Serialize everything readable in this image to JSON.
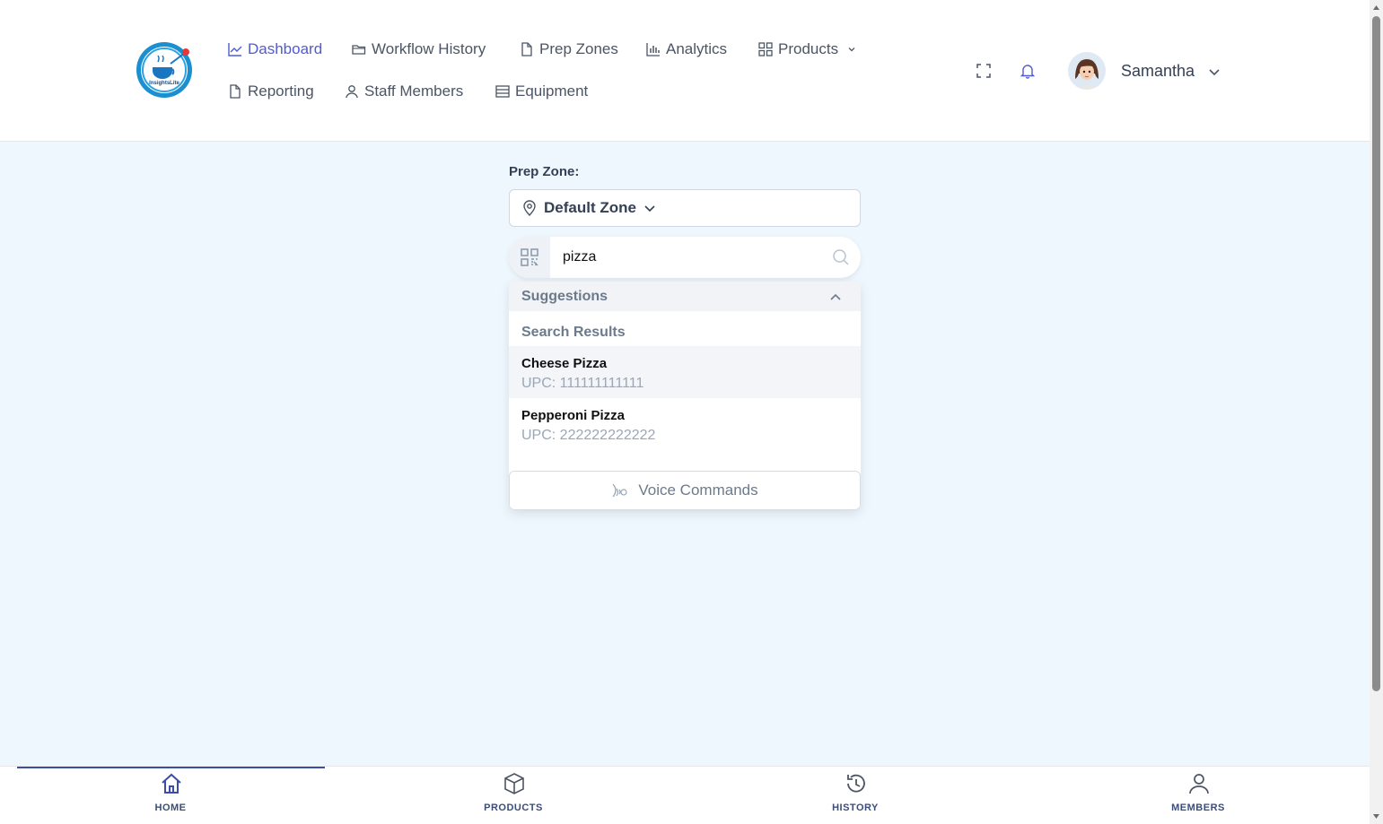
{
  "header": {
    "logo_text": "InsightsLite",
    "nav": [
      {
        "label": "Dashboard",
        "icon": "chart-line-icon",
        "active": true
      },
      {
        "label": "Workflow History",
        "icon": "folder-icon"
      },
      {
        "label": "Prep Zones",
        "icon": "file-icon"
      },
      {
        "label": "Analytics",
        "icon": "bar-chart-icon"
      },
      {
        "label": "Products",
        "icon": "grid-icon",
        "has_dropdown": true
      },
      {
        "label": "Reporting",
        "icon": "file-icon"
      },
      {
        "label": "Staff Members",
        "icon": "user-icon"
      },
      {
        "label": "Equipment",
        "icon": "list-icon"
      }
    ],
    "user": {
      "name": "Samantha"
    }
  },
  "main": {
    "zone_label": "Prep Zone:",
    "zone_value": "Default Zone",
    "search": {
      "value": "pizza",
      "placeholder": ""
    },
    "suggestions": {
      "header": "Suggestions",
      "results_title": "Search Results",
      "results": [
        {
          "name": "Cheese Pizza",
          "upc": "UPC: 111111111111"
        },
        {
          "name": "Pepperoni Pizza",
          "upc": "UPC: 222222222222"
        }
      ],
      "voice_label": "Voice Commands"
    }
  },
  "bottom_nav": [
    {
      "label": "HOME",
      "icon": "home-icon",
      "active": true
    },
    {
      "label": "PRODUCTS",
      "icon": "box-icon"
    },
    {
      "label": "HISTORY",
      "icon": "history-icon"
    },
    {
      "label": "MEMBERS",
      "icon": "user-icon"
    }
  ],
  "colors": {
    "accent": "#4f5bd5",
    "page_bg": "#eef7fd",
    "bottom_nav_active": "#3a4ea3"
  }
}
